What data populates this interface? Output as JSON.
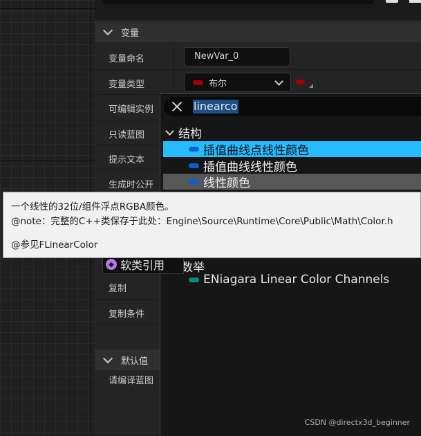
{
  "variables_section": {
    "title": "变量"
  },
  "rows": {
    "name_label": "变量命名",
    "type_label": "变量类型",
    "editable_label": "可编辑实例",
    "readonly_label": "只读蓝图",
    "tooltip_label": "提示文本",
    "expose_label": "生成时公开",
    "replication_label": "复制",
    "replication_cond_label": "复制条件"
  },
  "name_input": {
    "value": "NewVar_0"
  },
  "type_select": {
    "value": "布尔",
    "pill_color": "#a40000"
  },
  "container_pill_color": "#a40000",
  "defaults_section": {
    "title": "默认值",
    "compile_hint": "请编译蓝图"
  },
  "type_picker": {
    "search_value": "linearco",
    "category": "结构",
    "options": [
      {
        "label": "插值曲线点线性颜色",
        "pill_color": "#0a5fd6"
      },
      {
        "label": "插值曲线线性颜色",
        "pill_color": "#0a5fd6"
      },
      {
        "label": "线性颜色",
        "pill_color": "#0a5fd6"
      }
    ],
    "enum_category_fragment": "数举",
    "enum_option": {
      "label": "ENiagara Linear Color Channels",
      "pill_color": "#0e8a7a"
    },
    "soft_class_label": "软类引用",
    "highlight_color": "#26bbff"
  },
  "tooltip": {
    "line1": "一个线性的32位/组件浮点RGBA颜色。",
    "line2": "@note：完整的C++类保存于此处：Engine\\Source\\Runtime\\Core\\Public\\Math\\Color.h",
    "line3": "@参见FLinearColor"
  },
  "watermark": "CSDN @directx3d_beginner"
}
